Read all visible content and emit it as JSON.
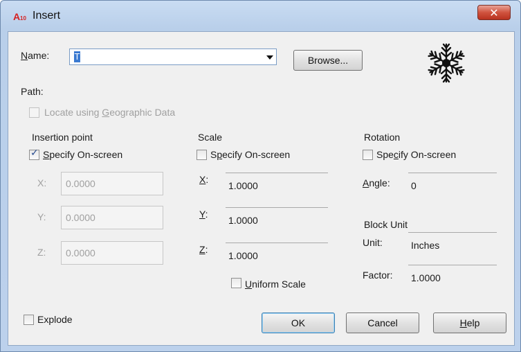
{
  "window": {
    "title": "Insert",
    "close_symbol": "✕",
    "icon": "autocad-app-icon"
  },
  "name": {
    "label_accel": "N",
    "label_rest": "ame:",
    "value": "T",
    "browse_label": "Browse..."
  },
  "path": {
    "label": "Path:"
  },
  "geo": {
    "label_pre": "Locate using ",
    "label_accel": "G",
    "label_post": "eographic Data",
    "checked": false,
    "enabled": false
  },
  "insertion": {
    "header": "Insertion point",
    "specify_accel": "S",
    "specify_rest": "pecify On-screen",
    "specify_checked": true,
    "x_label": "X:",
    "x_value": "0.0000",
    "y_label": "Y:",
    "y_value": "0.0000",
    "z_label": "Z:",
    "z_value": "0.0000"
  },
  "scale": {
    "header": "Scale",
    "specify_pre": "S",
    "specify_accel": "p",
    "specify_rest": "ecify On-screen",
    "specify_checked": false,
    "x_accel": "X",
    "x_value": "1.0000",
    "y_accel": "Y",
    "y_value": "1.0000",
    "z_accel": "Z",
    "z_value": "1.0000",
    "uniform_accel": "U",
    "uniform_rest": "niform Scale",
    "uniform_checked": false
  },
  "rotation": {
    "header": "Rotation",
    "specify_pre": "Spe",
    "specify_accel": "c",
    "specify_rest": "ify On-screen",
    "specify_checked": false,
    "angle_accel": "A",
    "angle_rest": "ngle:",
    "angle_value": "0"
  },
  "block_unit": {
    "header": "Block Unit",
    "unit_label": "Unit:",
    "unit_value": "Inches",
    "factor_label": "Factor:",
    "factor_value": "1.0000"
  },
  "explode": {
    "accel": "D",
    "pre": "",
    "label": "Explode",
    "checked": false
  },
  "buttons": {
    "ok": "OK",
    "cancel": "Cancel",
    "help_accel": "H",
    "help_rest": "elp"
  },
  "colors": {
    "title_bar": "#c9dcf2",
    "close_button": "#c94a36",
    "dialog_bg": "#f0f0f0",
    "check": "#274b8f"
  }
}
